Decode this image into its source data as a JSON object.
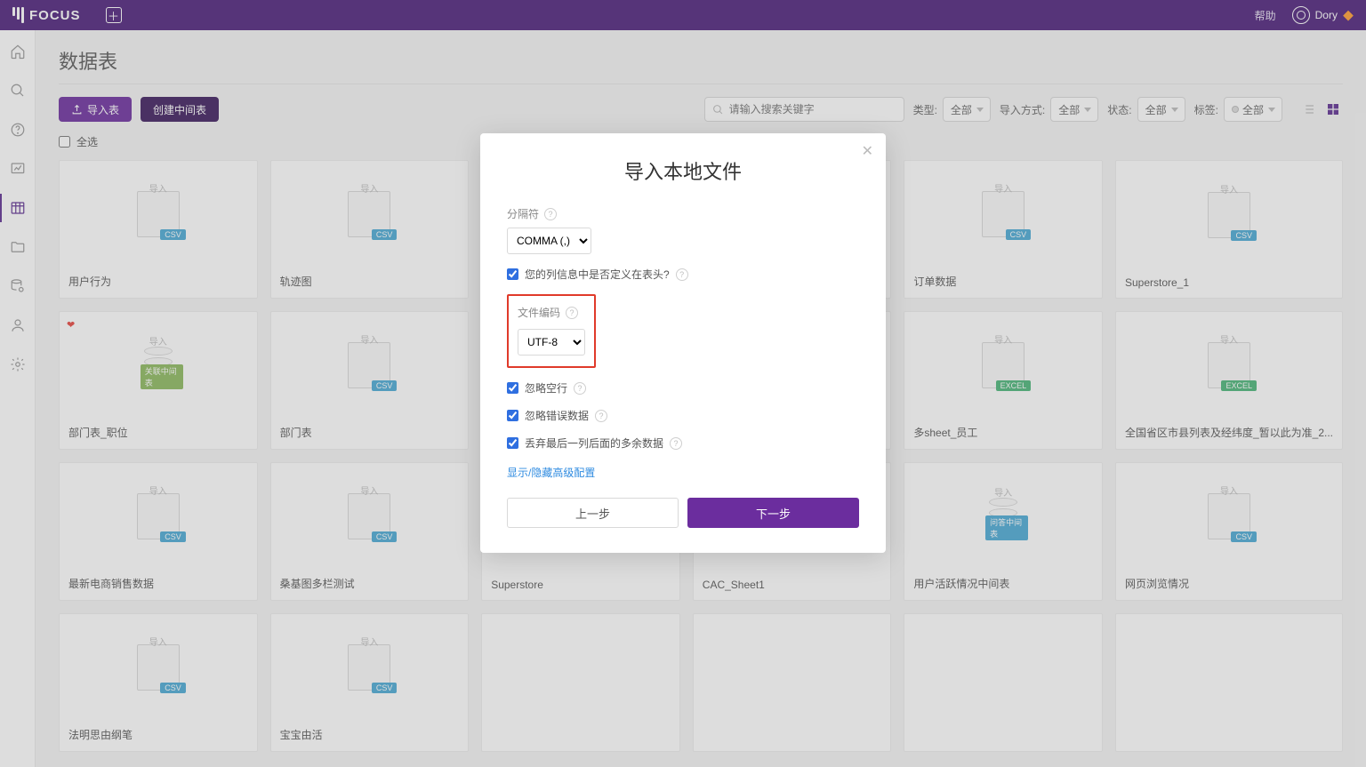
{
  "header": {
    "brand": "FOCUS",
    "help": "帮助",
    "user": "Dory"
  },
  "page": {
    "title": "数据表",
    "import_btn": "导入表",
    "create_btn": "创建中间表",
    "search_placeholder": "请输入搜索关键字",
    "select_all": "全选"
  },
  "filters": {
    "type_label": "类型:",
    "type_value": "全部",
    "import_label": "导入方式:",
    "import_value": "全部",
    "status_label": "状态:",
    "status_value": "全部",
    "tag_label": "标签:",
    "tag_value": "全部"
  },
  "icon_labels": {
    "import": "导入"
  },
  "badges": {
    "csv": "CSV",
    "assoc": "关联中间表",
    "excel": "EXCEL",
    "qa": "问答中间表"
  },
  "cards": [
    {
      "name": "用户行为",
      "type": "csv"
    },
    {
      "name": "轨迹图",
      "type": "csv"
    },
    {
      "name": "",
      "type": "blank"
    },
    {
      "name": "",
      "type": "blank"
    },
    {
      "name": "订单数据",
      "type": "csv"
    },
    {
      "name": "Superstore_1",
      "type": "csv"
    },
    {
      "name": "部门表_职位",
      "type": "assoc",
      "fav": true
    },
    {
      "name": "部门表",
      "type": "csv"
    },
    {
      "name": "",
      "type": "blank"
    },
    {
      "name": "",
      "type": "blank"
    },
    {
      "name": "多sheet_员工",
      "type": "excel"
    },
    {
      "name": "全国省区市县列表及经纬度_暂以此为准_2...",
      "type": "excel"
    },
    {
      "name": "最新电商销售数据",
      "type": "csv"
    },
    {
      "name": "桑基图多栏测试",
      "type": "csv"
    },
    {
      "name": "Superstore",
      "type": "blank_name"
    },
    {
      "name": "CAC_Sheet1",
      "type": "blank_name"
    },
    {
      "name": "用户活跃情况中间表",
      "type": "qa"
    },
    {
      "name": "网页浏览情况",
      "type": "csv"
    },
    {
      "name": "法明思由纲笔",
      "type": "csv"
    },
    {
      "name": "宝宝由活",
      "type": "csv"
    },
    {
      "name": "",
      "type": "blank"
    },
    {
      "name": "",
      "type": "blank"
    },
    {
      "name": "",
      "type": "blank"
    },
    {
      "name": "",
      "type": "blank"
    }
  ],
  "modal": {
    "title": "导入本地文件",
    "delimiter_label": "分隔符",
    "delimiter_value": "COMMA (,)",
    "header_row": "您的列信息中是否定义在表头?",
    "encoding_label": "文件编码",
    "encoding_value": "UTF-8",
    "ignore_blank": "忽略空行",
    "ignore_error": "忽略错误数据",
    "drop_extra": "丢弃最后一列后面的多余数据",
    "adv_toggle": "显示/隐藏高级配置",
    "prev": "上一步",
    "next": "下一步"
  }
}
